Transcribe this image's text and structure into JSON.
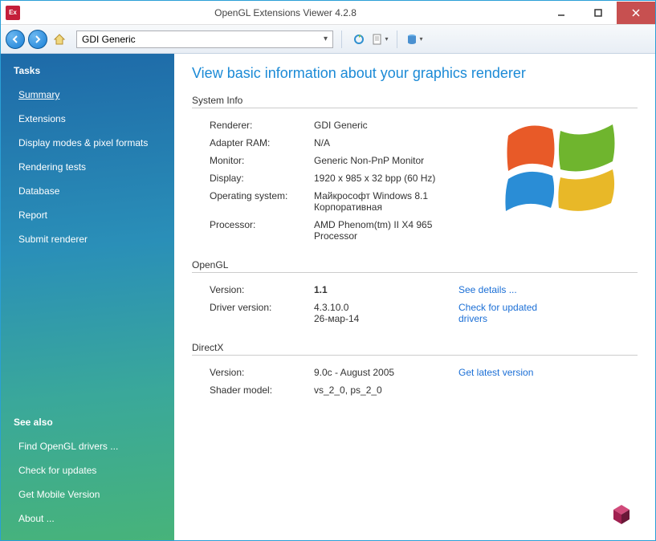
{
  "titlebar": {
    "title": "OpenGL Extensions Viewer 4.2.8"
  },
  "toolbar": {
    "renderer_selected": "GDI Generic"
  },
  "sidebar": {
    "tasks_header": "Tasks",
    "items": [
      {
        "label": "Summary"
      },
      {
        "label": "Extensions"
      },
      {
        "label": "Display modes & pixel formats"
      },
      {
        "label": "Rendering tests"
      },
      {
        "label": "Database"
      },
      {
        "label": "Report"
      },
      {
        "label": "Submit renderer"
      }
    ],
    "seealso_header": "See also",
    "seealso": [
      {
        "label": "Find OpenGL drivers ..."
      },
      {
        "label": "Check for updates"
      },
      {
        "label": "Get Mobile Version"
      },
      {
        "label": "About ..."
      }
    ]
  },
  "content": {
    "page_title": "View basic information about your graphics renderer",
    "system_info": {
      "header": "System Info",
      "renderer_label": "Renderer:",
      "renderer_value": "GDI Generic",
      "adapter_ram_label": "Adapter RAM:",
      "adapter_ram_value": "N/A",
      "monitor_label": "Monitor:",
      "monitor_value": "Generic Non-PnP Monitor",
      "display_label": "Display:",
      "display_value": "1920 x 985 x 32 bpp (60 Hz)",
      "os_label": "Operating system:",
      "os_value": "Майкрософт Windows 8.1 Корпоративная",
      "processor_label": "Processor:",
      "processor_value": "AMD Phenom(tm) II X4 965 Processor"
    },
    "opengl": {
      "header": "OpenGL",
      "version_label": "Version:",
      "version_value": "1.1",
      "details_link": "See details ...",
      "driver_label": "Driver version:",
      "driver_value": "4.3.10.0\n26-мар-14",
      "drivers_link": "Check for updated drivers"
    },
    "directx": {
      "header": "DirectX",
      "version_label": "Version:",
      "version_value": "9.0c - August 2005",
      "latest_link": "Get latest version",
      "shader_label": "Shader model:",
      "shader_value": "vs_2_0, ps_2_0"
    }
  }
}
